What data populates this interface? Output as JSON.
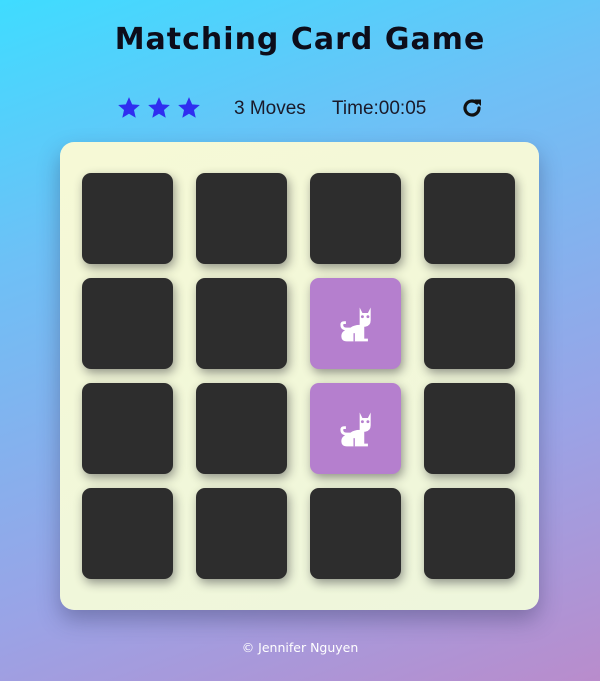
{
  "header": {
    "title": "Matching Card Game"
  },
  "score_panel": {
    "stars_count": 3,
    "star_color": "#2f2ef0",
    "moves_label": "3 Moves",
    "timer_label": "Time:00:05",
    "restart_icon": "redo-icon"
  },
  "deck": {
    "rows": 4,
    "cols": 4,
    "card_back_color": "#2d2d2d",
    "card_open_color": "#b57fce",
    "open_icon": "cat-icon",
    "cards": [
      {
        "state": "closed"
      },
      {
        "state": "closed"
      },
      {
        "state": "closed"
      },
      {
        "state": "closed"
      },
      {
        "state": "closed"
      },
      {
        "state": "closed"
      },
      {
        "state": "open",
        "icon": "cat-icon"
      },
      {
        "state": "closed"
      },
      {
        "state": "closed"
      },
      {
        "state": "closed"
      },
      {
        "state": "open",
        "icon": "cat-icon"
      },
      {
        "state": "closed"
      },
      {
        "state": "closed"
      },
      {
        "state": "closed"
      },
      {
        "state": "closed"
      },
      {
        "state": "closed"
      }
    ]
  },
  "footer": {
    "credit": "© Jennifer Nguyen"
  }
}
